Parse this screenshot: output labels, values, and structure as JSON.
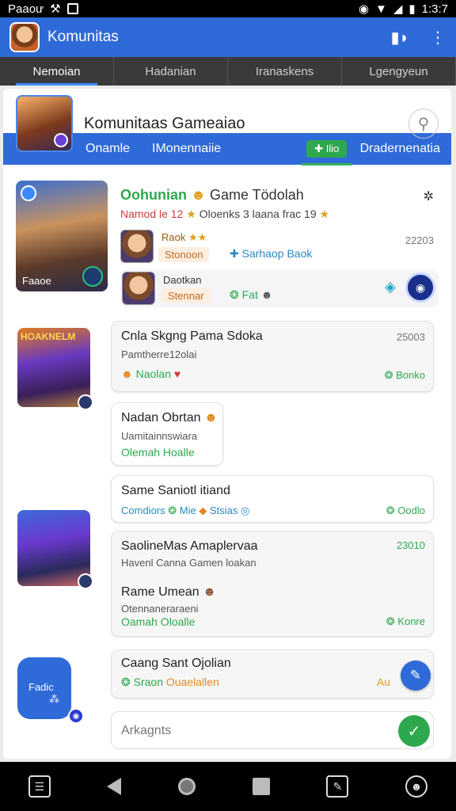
{
  "status": {
    "carrier": "Paaoư",
    "time": "1:3:7"
  },
  "appbar": {
    "title": "Komunitas"
  },
  "tabs": [
    "Nemoian",
    "Hadanian",
    "Iranaskens",
    "Lgengyeun"
  ],
  "community": {
    "title": "Komunitaas Gameaiao",
    "strip": {
      "item1": "Onamle",
      "item2": "IMonennaiie",
      "tag": "Ilio",
      "right": "Dradernenatia"
    }
  },
  "post": {
    "title_green": "Oohunian",
    "title_rest": "Game Tödolah",
    "sub_red": "Namod le 12",
    "sub_rest": "Oloenks 3 laana frac 19",
    "thumb_label": "Faaoe",
    "row1": {
      "name": "Raok",
      "chip": "Stonoon",
      "blue": "Sarhaop Baok",
      "time": "22203"
    },
    "row2": {
      "name": "Daotkan",
      "chip": "Stennar",
      "green": "Fat"
    }
  },
  "thumbs": {
    "t2_label": "HOAKNELM",
    "t4_label": "Fadic"
  },
  "messages": [
    {
      "title": "Cnla Skgng Pama Sdoka",
      "sub": "Pamtherre12olai",
      "left": "Naolan",
      "right": "Bonko",
      "time": "25003"
    },
    {
      "title": "Nadan Obrtan",
      "sub": "Uamitainnswiara",
      "line": "Olemah Hoalle"
    },
    {
      "title": "Same Saniotl itiand",
      "line_blue": "Comdiors",
      "line_mid": "Mie",
      "line_end": "Stsias",
      "right": "Oodlo"
    },
    {
      "title": "SaolineMas Amaplervaa",
      "time": "23010",
      "sub": "Havenl Canna Gamen loakan",
      "title2": "Rame Umean",
      "sub2": "Otennaneraraeni",
      "line": "Oamah Oloalle",
      "right": "Konre"
    },
    {
      "title": "Caang Sant Ojolian",
      "line": "Sraon",
      "line_o": "Ouaelallen",
      "right": "Au"
    }
  ],
  "input": {
    "placeholder": "Arkagnts"
  },
  "colors": {
    "primary": "#2f6ad9",
    "green": "#2ea84e",
    "dark_tab": "#3a3a3a"
  }
}
